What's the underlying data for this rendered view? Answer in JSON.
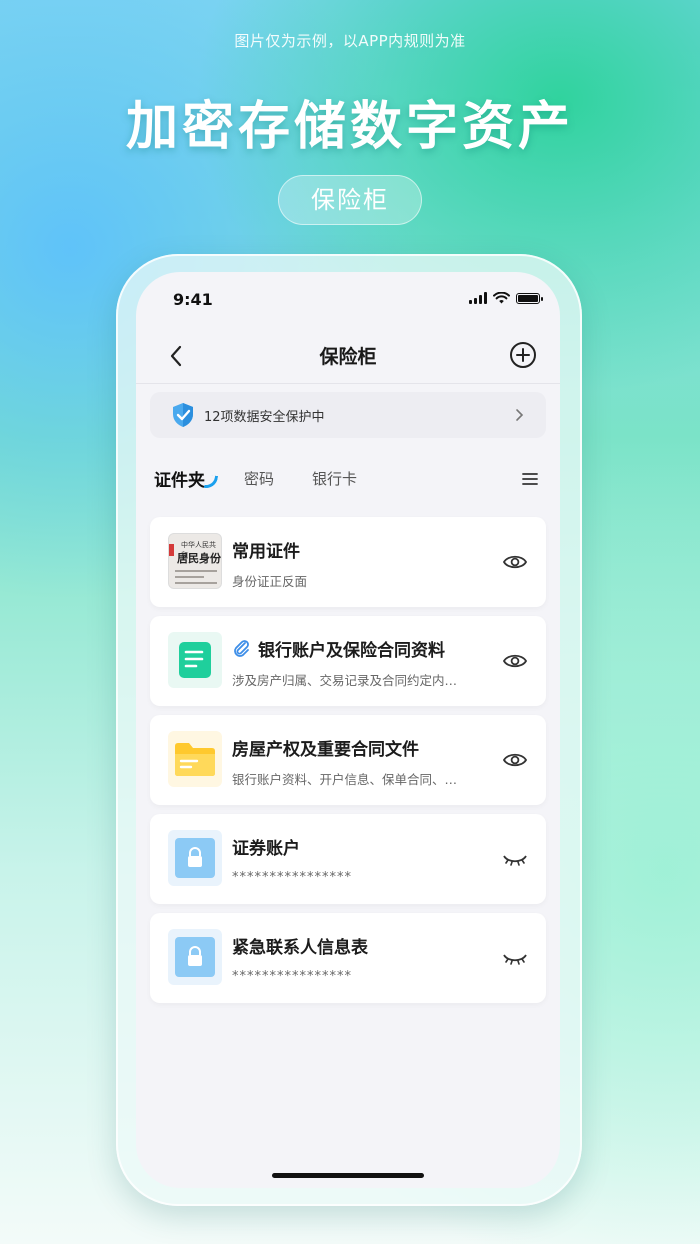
{
  "promo": {
    "disclaimer": "图片仅为示例，以APP内规则为准",
    "headline": "加密存储数字资产",
    "pill_label": "保险柜"
  },
  "status_bar": {
    "time": "9:41"
  },
  "nav": {
    "title": "保险柜"
  },
  "security_banner": {
    "text": "12项数据安全保护中"
  },
  "tabs": [
    {
      "label": "证件夹",
      "active": true
    },
    {
      "label": "密码",
      "active": false
    },
    {
      "label": "银行卡",
      "active": false
    }
  ],
  "items": [
    {
      "title": "常用证件",
      "subtitle": "身份证正反面",
      "thumb": "id-card-image",
      "visible": true
    },
    {
      "title": "银行账户及保险合同资料",
      "subtitle": "涉及房产归属、交易记录及合同约定内…",
      "thumb": "document-icon",
      "attachment": true,
      "visible": true
    },
    {
      "title": "房屋产权及重要合同文件",
      "subtitle": "银行账户资料、开户信息、保单合同、…",
      "thumb": "folder-icon",
      "visible": true
    },
    {
      "title": "证券账户",
      "subtitle": "****************",
      "thumb": "lock-icon",
      "visible": false
    },
    {
      "title": "紧急联系人信息表",
      "subtitle": "****************",
      "thumb": "lock-icon",
      "visible": false
    }
  ],
  "id_card_preview": {
    "line1": "中华人民共和",
    "line2": "居民身份"
  },
  "colors": {
    "accent_blue": "#1aa0ee",
    "doc_green": "#1fcf9c",
    "folder_yellow": "#ffc92e",
    "lock_blue": "#7cc2f2"
  }
}
